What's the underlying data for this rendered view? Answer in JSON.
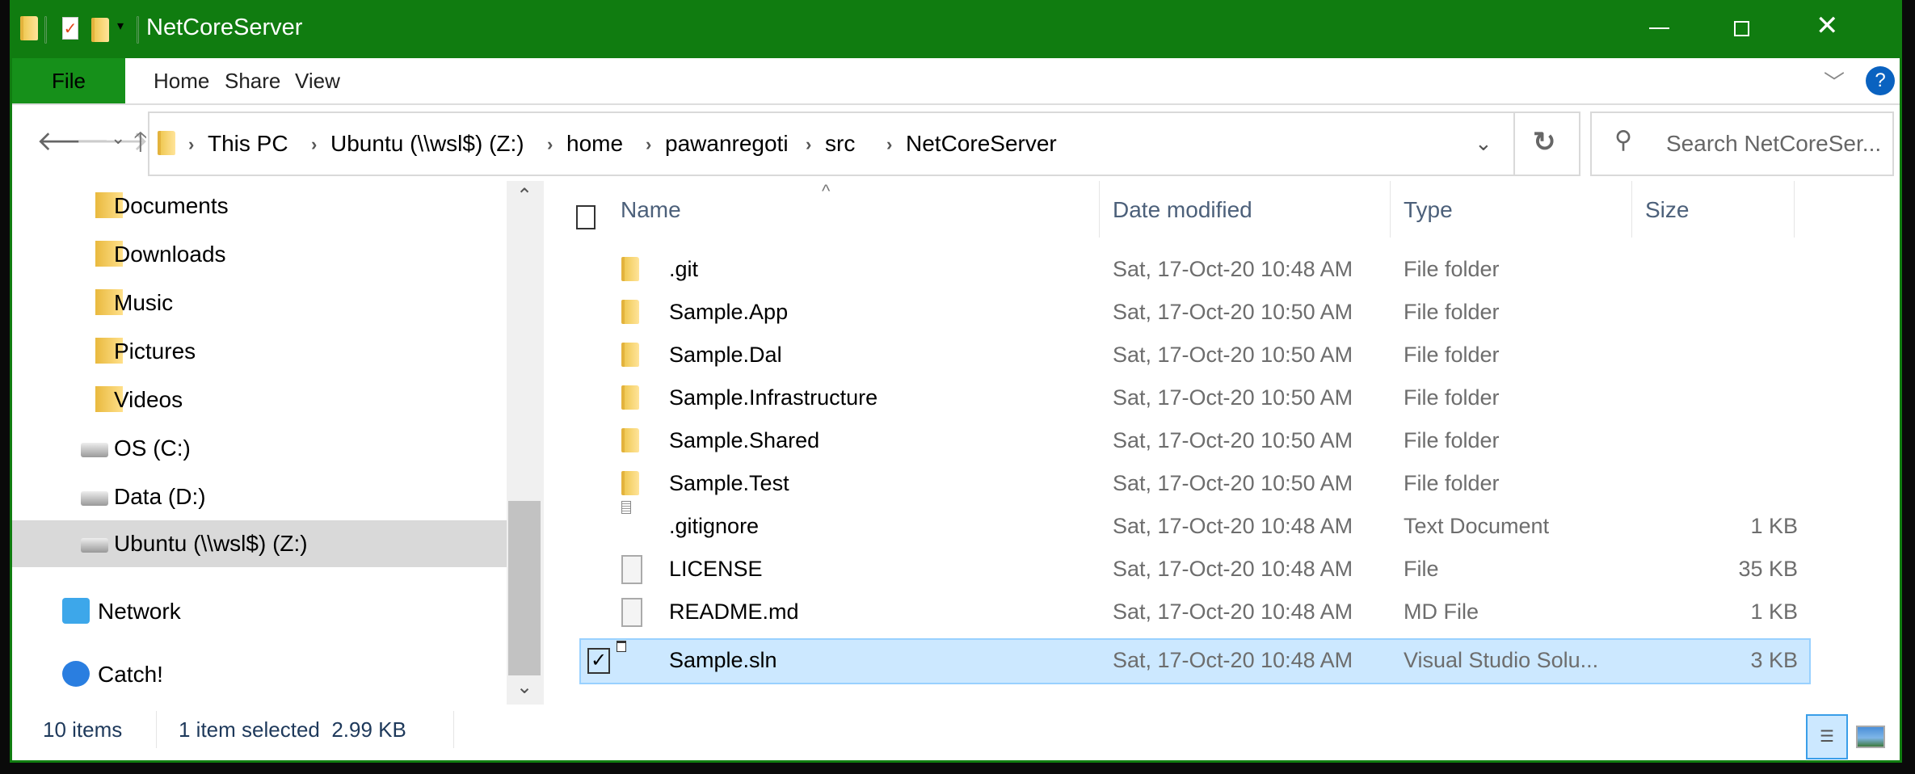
{
  "window": {
    "title": "NetCoreServer",
    "accent": "#107c10",
    "controls": {
      "minimize": "minimize-icon",
      "maximize": "maximize-icon",
      "close": "close-icon"
    }
  },
  "ribbon": {
    "tabs": [
      {
        "label": "File"
      },
      {
        "label": "Home"
      },
      {
        "label": "Share"
      },
      {
        "label": "View"
      }
    ],
    "help": "?"
  },
  "address": {
    "crumbs": [
      "This PC",
      "Ubuntu (\\\\wsl$) (Z:)",
      "home",
      "pawanregoti",
      "src",
      "NetCoreServer"
    ],
    "search_placeholder": "Search NetCoreSer..."
  },
  "nav": {
    "items": [
      {
        "label": "Documents",
        "icon": "documents-folder-icon"
      },
      {
        "label": "Downloads",
        "icon": "downloads-folder-icon"
      },
      {
        "label": "Music",
        "icon": "music-folder-icon"
      },
      {
        "label": "Pictures",
        "icon": "pictures-folder-icon"
      },
      {
        "label": "Videos",
        "icon": "videos-folder-icon"
      },
      {
        "label": "OS (C:)",
        "icon": "windows-drive-icon"
      },
      {
        "label": "Data (D:)",
        "icon": "drive-icon"
      },
      {
        "label": "Ubuntu (\\\\wsl$) (Z:)",
        "icon": "network-drive-icon",
        "selected": true
      },
      {
        "label": "Network",
        "icon": "network-icon"
      },
      {
        "label": "Catch!",
        "icon": "catch-icon"
      }
    ]
  },
  "list": {
    "columns": [
      "Name",
      "Date modified",
      "Type",
      "Size"
    ],
    "sorted_by": "Name",
    "rows": [
      {
        "name": ".git",
        "date": "Sat, 17-Oct-20 10:48 AM",
        "type": "File folder",
        "size": "",
        "icon": "folder"
      },
      {
        "name": "Sample.App",
        "date": "Sat, 17-Oct-20 10:50 AM",
        "type": "File folder",
        "size": "",
        "icon": "folder"
      },
      {
        "name": "Sample.Dal",
        "date": "Sat, 17-Oct-20 10:50 AM",
        "type": "File folder",
        "size": "",
        "icon": "folder"
      },
      {
        "name": "Sample.Infrastructure",
        "date": "Sat, 17-Oct-20 10:50 AM",
        "type": "File folder",
        "size": "",
        "icon": "folder"
      },
      {
        "name": "Sample.Shared",
        "date": "Sat, 17-Oct-20 10:50 AM",
        "type": "File folder",
        "size": "",
        "icon": "folder"
      },
      {
        "name": "Sample.Test",
        "date": "Sat, 17-Oct-20 10:50 AM",
        "type": "File folder",
        "size": "",
        "icon": "folder"
      },
      {
        "name": ".gitignore",
        "date": "Sat, 17-Oct-20 10:48 AM",
        "type": "Text Document",
        "size": "1 KB",
        "icon": "text"
      },
      {
        "name": "LICENSE",
        "date": "Sat, 17-Oct-20 10:48 AM",
        "type": "File",
        "size": "35 KB",
        "icon": "file"
      },
      {
        "name": "README.md",
        "date": "Sat, 17-Oct-20 10:48 AM",
        "type": "MD File",
        "size": "1 KB",
        "icon": "file"
      },
      {
        "name": "Sample.sln",
        "date": "Sat, 17-Oct-20 10:48 AM",
        "type": "Visual Studio Solu...",
        "size": "3 KB",
        "icon": "sln",
        "selected": true
      }
    ]
  },
  "status": {
    "count": "10 items",
    "selection": "1 item selected  2.99 KB"
  }
}
